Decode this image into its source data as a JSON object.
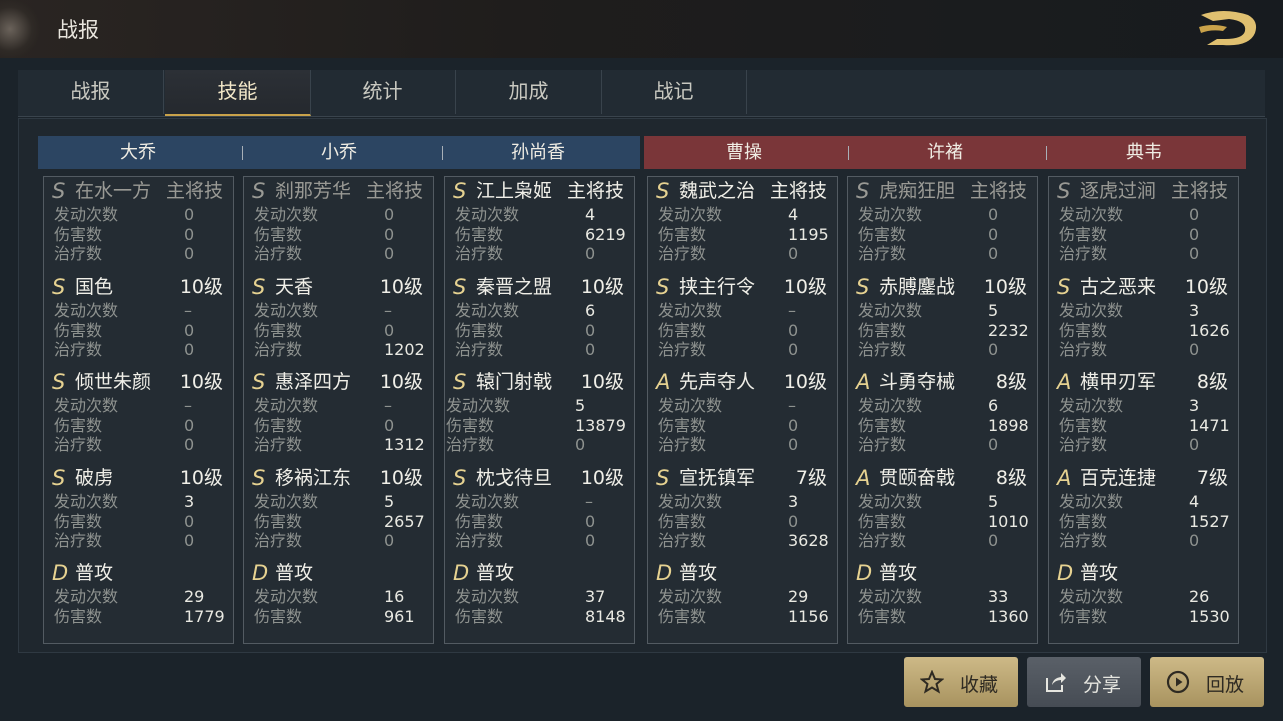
{
  "topbar": {
    "title": "战报",
    "back_icon": "dragon-back-icon"
  },
  "tabs": [
    {
      "label": "战报"
    },
    {
      "label": "技能"
    },
    {
      "label": "统计"
    },
    {
      "label": "加成"
    },
    {
      "label": "战记"
    }
  ],
  "active_tab": "技能",
  "colors": {
    "blue_team": "#2c4562",
    "red_team": "#7a3639",
    "accent": "#c9a24a",
    "grade": "#e6d291"
  },
  "heroes": [
    {
      "name": "大乔",
      "skills": [
        {
          "grade": "S",
          "name": "在水一方",
          "level": "主将技",
          "stats": [
            "0",
            "0",
            "0"
          ]
        },
        {
          "grade": "S",
          "name": "国色",
          "level": "10级",
          "stats": [
            "–",
            "0",
            "0"
          ]
        },
        {
          "grade": "S",
          "name": "倾世朱颜",
          "level": "10级",
          "stats": [
            "–",
            "0",
            "0"
          ]
        },
        {
          "grade": "S",
          "name": "破虏",
          "level": "10级",
          "stats": [
            "3",
            "0",
            "0"
          ]
        },
        {
          "grade": "D",
          "name": "普攻",
          "level": "",
          "stats": [
            "29",
            "1779"
          ]
        }
      ]
    },
    {
      "name": "小乔",
      "skills": [
        {
          "grade": "S",
          "name": "刹那芳华",
          "level": "主将技",
          "stats": [
            "0",
            "0",
            "0"
          ]
        },
        {
          "grade": "S",
          "name": "天香",
          "level": "10级",
          "stats": [
            "–",
            "0",
            "1202"
          ]
        },
        {
          "grade": "S",
          "name": "惠泽四方",
          "level": "10级",
          "stats": [
            "–",
            "0",
            "1312"
          ]
        },
        {
          "grade": "S",
          "name": "移祸江东",
          "level": "10级",
          "stats": [
            "5",
            "2657",
            "0"
          ]
        },
        {
          "grade": "D",
          "name": "普攻",
          "level": "",
          "stats": [
            "16",
            "961"
          ]
        }
      ]
    },
    {
      "name": "孙尚香",
      "skills": [
        {
          "grade": "S",
          "name": "江上枭姬",
          "level": "主将技",
          "stats": [
            "4",
            "6219",
            "0"
          ]
        },
        {
          "grade": "S",
          "name": "秦晋之盟",
          "level": "10级",
          "stats": [
            "6",
            "0",
            "0"
          ]
        },
        {
          "grade": "S",
          "name": "辕门射戟",
          "level": "10级",
          "stats": [
            "5",
            "13879",
            "0"
          ]
        },
        {
          "grade": "S",
          "name": "枕戈待旦",
          "level": "10级",
          "stats": [
            "–",
            "0",
            "0"
          ]
        },
        {
          "grade": "D",
          "name": "普攻",
          "level": "",
          "stats": [
            "37",
            "8148"
          ]
        }
      ]
    },
    {
      "name": "曹操",
      "skills": [
        {
          "grade": "S",
          "name": "魏武之治",
          "level": "主将技",
          "stats": [
            "4",
            "1195",
            "0"
          ]
        },
        {
          "grade": "S",
          "name": "挟主行令",
          "level": "10级",
          "stats": [
            "–",
            "0",
            "0"
          ]
        },
        {
          "grade": "A",
          "name": "先声夺人",
          "level": "10级",
          "stats": [
            "–",
            "0",
            "0"
          ]
        },
        {
          "grade": "S",
          "name": "宣抚镇军",
          "level": "7级",
          "stats": [
            "3",
            "0",
            "3628"
          ]
        },
        {
          "grade": "D",
          "name": "普攻",
          "level": "",
          "stats": [
            "29",
            "1156"
          ]
        }
      ]
    },
    {
      "name": "许褚",
      "skills": [
        {
          "grade": "S",
          "name": "虎痴狂胆",
          "level": "主将技",
          "stats": [
            "0",
            "0",
            "0"
          ]
        },
        {
          "grade": "S",
          "name": "赤膊鏖战",
          "level": "10级",
          "stats": [
            "5",
            "2232",
            "0"
          ]
        },
        {
          "grade": "A",
          "name": "斗勇夺械",
          "level": "8级",
          "stats": [
            "6",
            "1898",
            "0"
          ]
        },
        {
          "grade": "A",
          "name": "贯颐奋戟",
          "level": "8级",
          "stats": [
            "5",
            "1010",
            "0"
          ]
        },
        {
          "grade": "D",
          "name": "普攻",
          "level": "",
          "stats": [
            "33",
            "1360"
          ]
        }
      ]
    },
    {
      "name": "典韦",
      "skills": [
        {
          "grade": "S",
          "name": "逐虎过涧",
          "level": "主将技",
          "stats": [
            "0",
            "0",
            "0"
          ]
        },
        {
          "grade": "S",
          "name": "古之恶来",
          "level": "10级",
          "stats": [
            "3",
            "1626",
            "0"
          ]
        },
        {
          "grade": "A",
          "name": "横甲刃军",
          "level": "8级",
          "stats": [
            "3",
            "1471",
            "0"
          ]
        },
        {
          "grade": "A",
          "name": "百克连捷",
          "level": "7级",
          "stats": [
            "4",
            "1527",
            "0"
          ]
        },
        {
          "grade": "D",
          "name": "普攻",
          "level": "",
          "stats": [
            "26",
            "1530"
          ]
        }
      ]
    }
  ],
  "stat_labels": [
    "发动次数",
    "伤害数",
    "治疗数"
  ],
  "buttons": [
    {
      "label": "收藏",
      "icon": "star-icon"
    },
    {
      "label": "分享",
      "icon": "share-icon"
    },
    {
      "label": "回放",
      "icon": "play-icon"
    }
  ]
}
